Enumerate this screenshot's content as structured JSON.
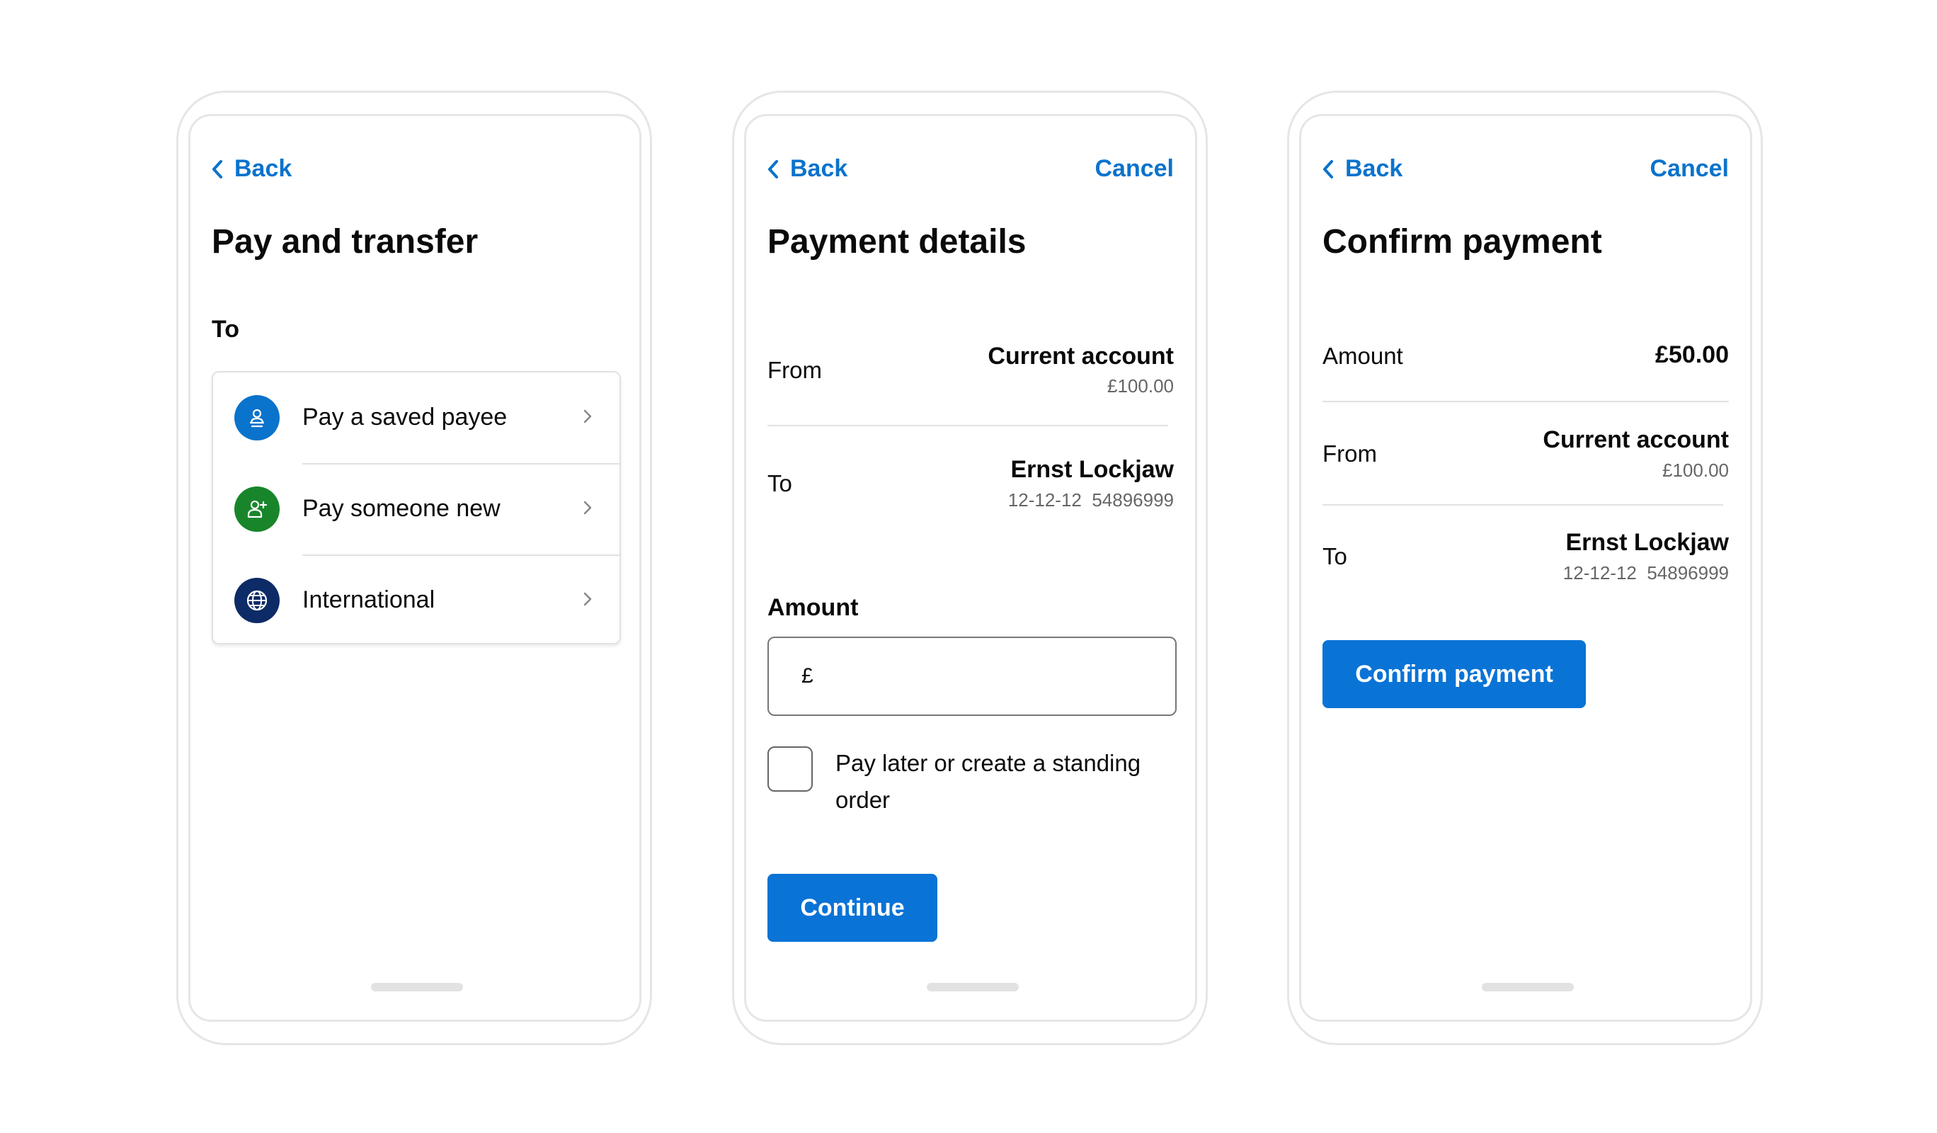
{
  "colors": {
    "accent": "#0a73cc",
    "button": "#0a73d6",
    "icon_blue": "#0a73cc",
    "icon_green": "#18852b",
    "icon_navy": "#0d2b66"
  },
  "screen1": {
    "back": "Back",
    "title": "Pay and transfer",
    "to_label": "To",
    "options": [
      {
        "label": "Pay a saved payee",
        "icon": "saved-payee-icon"
      },
      {
        "label": "Pay someone new",
        "icon": "add-person-icon"
      },
      {
        "label": "International",
        "icon": "globe-icon"
      }
    ]
  },
  "screen2": {
    "back": "Back",
    "cancel": "Cancel",
    "title": "Payment details",
    "from_label": "From",
    "from_account": "Current account",
    "from_balance": "£100.00",
    "to_label": "To",
    "to_name": "Ernst Lockjaw",
    "to_details": "12-12-12  54896999",
    "amount_label": "Amount",
    "currency_symbol": "£",
    "checkbox_label": "Pay later or create a standing order",
    "continue": "Continue"
  },
  "screen3": {
    "back": "Back",
    "cancel": "Cancel",
    "title": "Confirm payment",
    "amount_label": "Amount",
    "amount_value": "£50.00",
    "from_label": "From",
    "from_account": "Current account",
    "from_balance": "£100.00",
    "to_label": "To",
    "to_name": "Ernst Lockjaw",
    "to_details": "12-12-12  54896999",
    "confirm": "Confirm payment"
  }
}
